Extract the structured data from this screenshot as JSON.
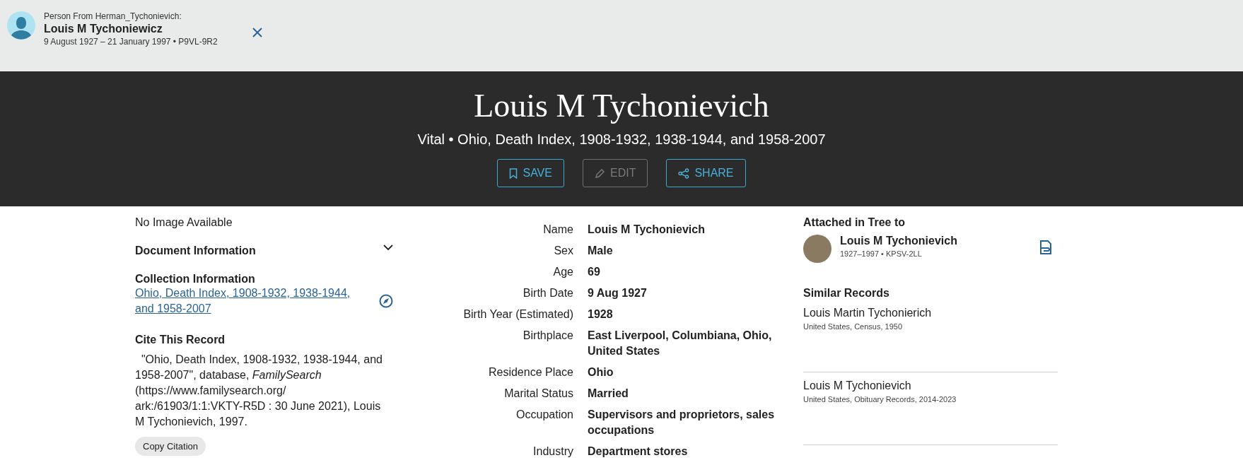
{
  "banner": {
    "label": "Person From Herman_Tychonievich:",
    "name": "Louis M Tychoniewicz",
    "details": "9 August 1927 – 21 January 1997 • P9VL-9R2"
  },
  "header": {
    "title": "Louis M Tychonievich",
    "subtitle": "Vital • Ohio, Death Index, 1908-1932, 1938-1944, and 1958-2007",
    "buttons": [
      {
        "kind": "save",
        "label": "SAVE",
        "disabled": false
      },
      {
        "kind": "edit",
        "label": "EDIT",
        "disabled": true
      },
      {
        "kind": "share",
        "label": "SHARE",
        "disabled": false
      }
    ]
  },
  "left": {
    "image_note": "No Image Available",
    "document_information": {
      "title": "Document Information",
      "expanded": false
    },
    "collection": {
      "title": "Collection Information",
      "link": "Ohio, Death Index, 1908-1932, 1938-1944, and 1958-2007"
    },
    "cite": {
      "title": "Cite This Record",
      "text": "\"Ohio, Death Index, 1908-1932, 1938-1944, and 1958-2007\", database, *FamilySearch* (https://www.familysearch.org/ ark:/61903/1:1:VKTY-R5D : 30 June 2021), Louis M Tychonievich, 1997.",
      "button": "Copy Citation"
    }
  },
  "facts": [
    {
      "label": "Name",
      "value": "Louis M Tychonievich"
    },
    {
      "label": "Sex",
      "value": "Male"
    },
    {
      "label": "Age",
      "value": "69"
    },
    {
      "label": "Birth Date",
      "value": "9 Aug 1927"
    },
    {
      "label": "Birth Year (Estimated)",
      "value": "1928"
    },
    {
      "label": "Birthplace",
      "value": "East Liverpool, Columbiana, Ohio, United States"
    },
    {
      "label": "Residence Place",
      "value": "Ohio"
    },
    {
      "label": "Marital Status",
      "value": "Married"
    },
    {
      "label": "Occupation",
      "value": "Supervisors and proprietors, sales occupations"
    },
    {
      "label": "Industry",
      "value": "Department stores"
    }
  ],
  "attached": {
    "title": "Attached in Tree to",
    "name": "Louis M Tychonievich",
    "details": "1927–1997 • KPSV-2LL"
  },
  "similar": {
    "title": "Similar Records",
    "items": [
      {
        "name": "Louis Martin Tychonierich",
        "collection": "United States, Census, 1950"
      },
      {
        "name": "Louis M Tychonievich",
        "collection": "United States, Obituary Records, 2014-2023"
      }
    ]
  }
}
